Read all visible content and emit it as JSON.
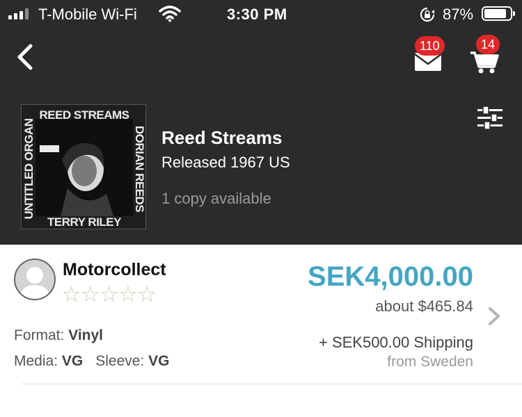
{
  "status_bar": {
    "carrier": "T-Mobile Wi-Fi",
    "time": "3:30 PM",
    "battery": "87%",
    "battery_level": 0.87
  },
  "nav": {
    "back_icon": "chevron-left-icon",
    "messages_badge": "110",
    "cart_badge": "14"
  },
  "release": {
    "title": "Reed Streams",
    "info": "Released 1967 US",
    "copies": "1 copy available",
    "cover": {
      "top_text": "REED STREAMS",
      "left_text": "UNTITLED ORGAN",
      "right_text": "DORIAN REEDS",
      "bottom_text": "TERRY RILEY"
    }
  },
  "listing": {
    "seller": "Motorcollect",
    "rating_stars": 0,
    "price": "SEK4,000.00",
    "approx": "about $465.84",
    "shipping": "+ SEK500.00 Shipping",
    "ships_from": "from Sweden",
    "format_label": "Format:",
    "format_value": "Vinyl",
    "media_label": "Media:",
    "media_value": "VG",
    "sleeve_label": "Sleeve:",
    "sleeve_value": "VG"
  },
  "colors": {
    "header_bg": "#2b2b2b",
    "price": "#45a6c3",
    "badge": "#e0282a"
  }
}
